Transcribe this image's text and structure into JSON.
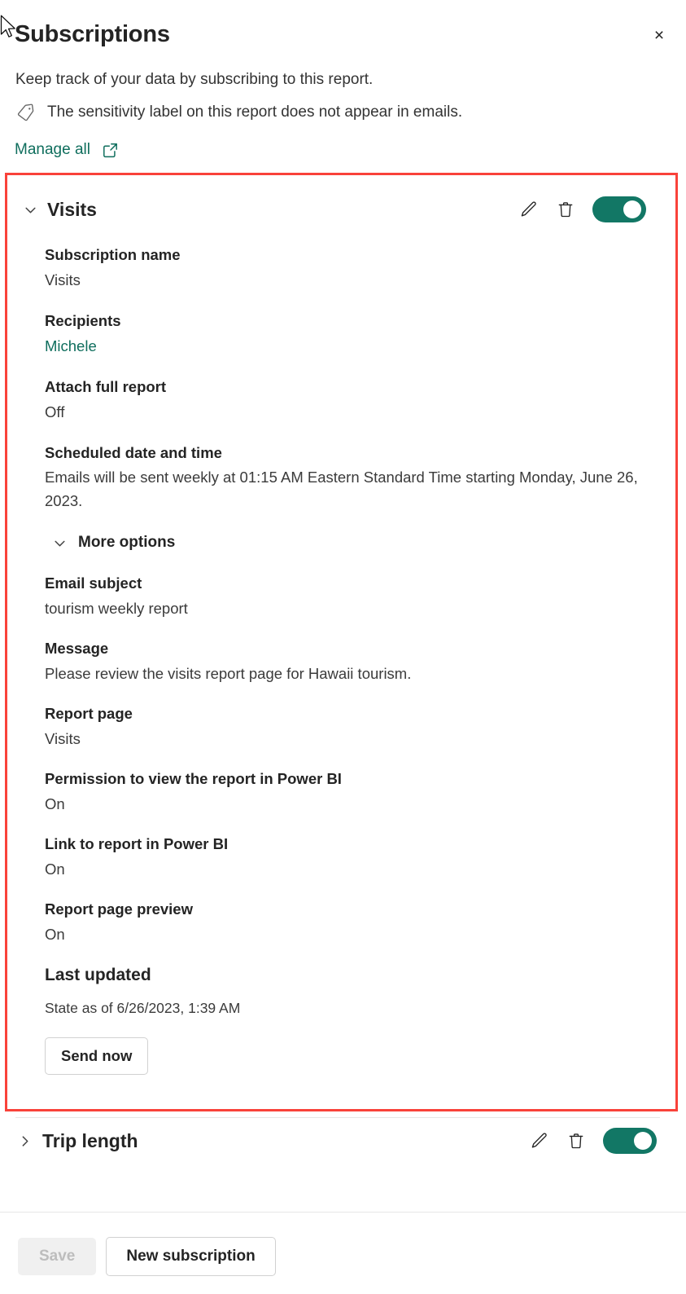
{
  "panel": {
    "title": "Subscriptions",
    "close_label": "×",
    "close_icon": "close-icon",
    "subtitle": "Keep track of your data by subscribing to this report.",
    "sensitivity_notice": "The sensitivity label on this report does not appear in emails.",
    "sensitivity_icon": "tag-icon",
    "manage_all_label": "Manage all",
    "manage_all_icon": "external-link-icon"
  },
  "colors": {
    "accent_teal": "#0f6e5d",
    "toggle_on": "#127765",
    "highlight_border": "#f9423a",
    "text_primary": "#242424",
    "text_secondary": "#3b3b3b"
  },
  "subscriptions": [
    {
      "name": "Visits",
      "expanded": true,
      "chevron_icon": "chevron-down-icon",
      "edit_icon": "pencil-icon",
      "delete_icon": "trash-icon",
      "toggle_state": "on",
      "fields": [
        {
          "label": "Subscription name",
          "value": "Visits"
        },
        {
          "label": "Recipients",
          "value": "Michele",
          "is_link": true
        },
        {
          "label": "Attach full report",
          "value": "Off"
        },
        {
          "label": "Scheduled date and time",
          "value": "Emails will be sent weekly at 01:15 AM Eastern Standard Time starting Monday, June 26, 2023."
        }
      ],
      "more_options_label": "More options",
      "more_options_icon": "chevron-down-icon",
      "more_fields": [
        {
          "label": "Email subject",
          "value": "tourism weekly report"
        },
        {
          "label": "Message",
          "value": "Please review the visits report page for Hawaii tourism."
        },
        {
          "label": "Report page",
          "value": "Visits"
        },
        {
          "label": "Permission to view the report in Power BI",
          "value": "On"
        },
        {
          "label": "Link to report in Power BI",
          "value": "On"
        },
        {
          "label": "Report page preview",
          "value": "On"
        }
      ],
      "last_updated_label": "Last updated",
      "last_updated_value": "State as of 6/26/2023, 1:39 AM",
      "send_now_label": "Send now"
    },
    {
      "name": "Trip length",
      "expanded": false,
      "chevron_icon": "chevron-right-icon",
      "edit_icon": "pencil-icon",
      "delete_icon": "trash-icon",
      "toggle_state": "on"
    }
  ],
  "footer": {
    "save_label": "Save",
    "save_disabled": true,
    "new_subscription_label": "New subscription"
  }
}
